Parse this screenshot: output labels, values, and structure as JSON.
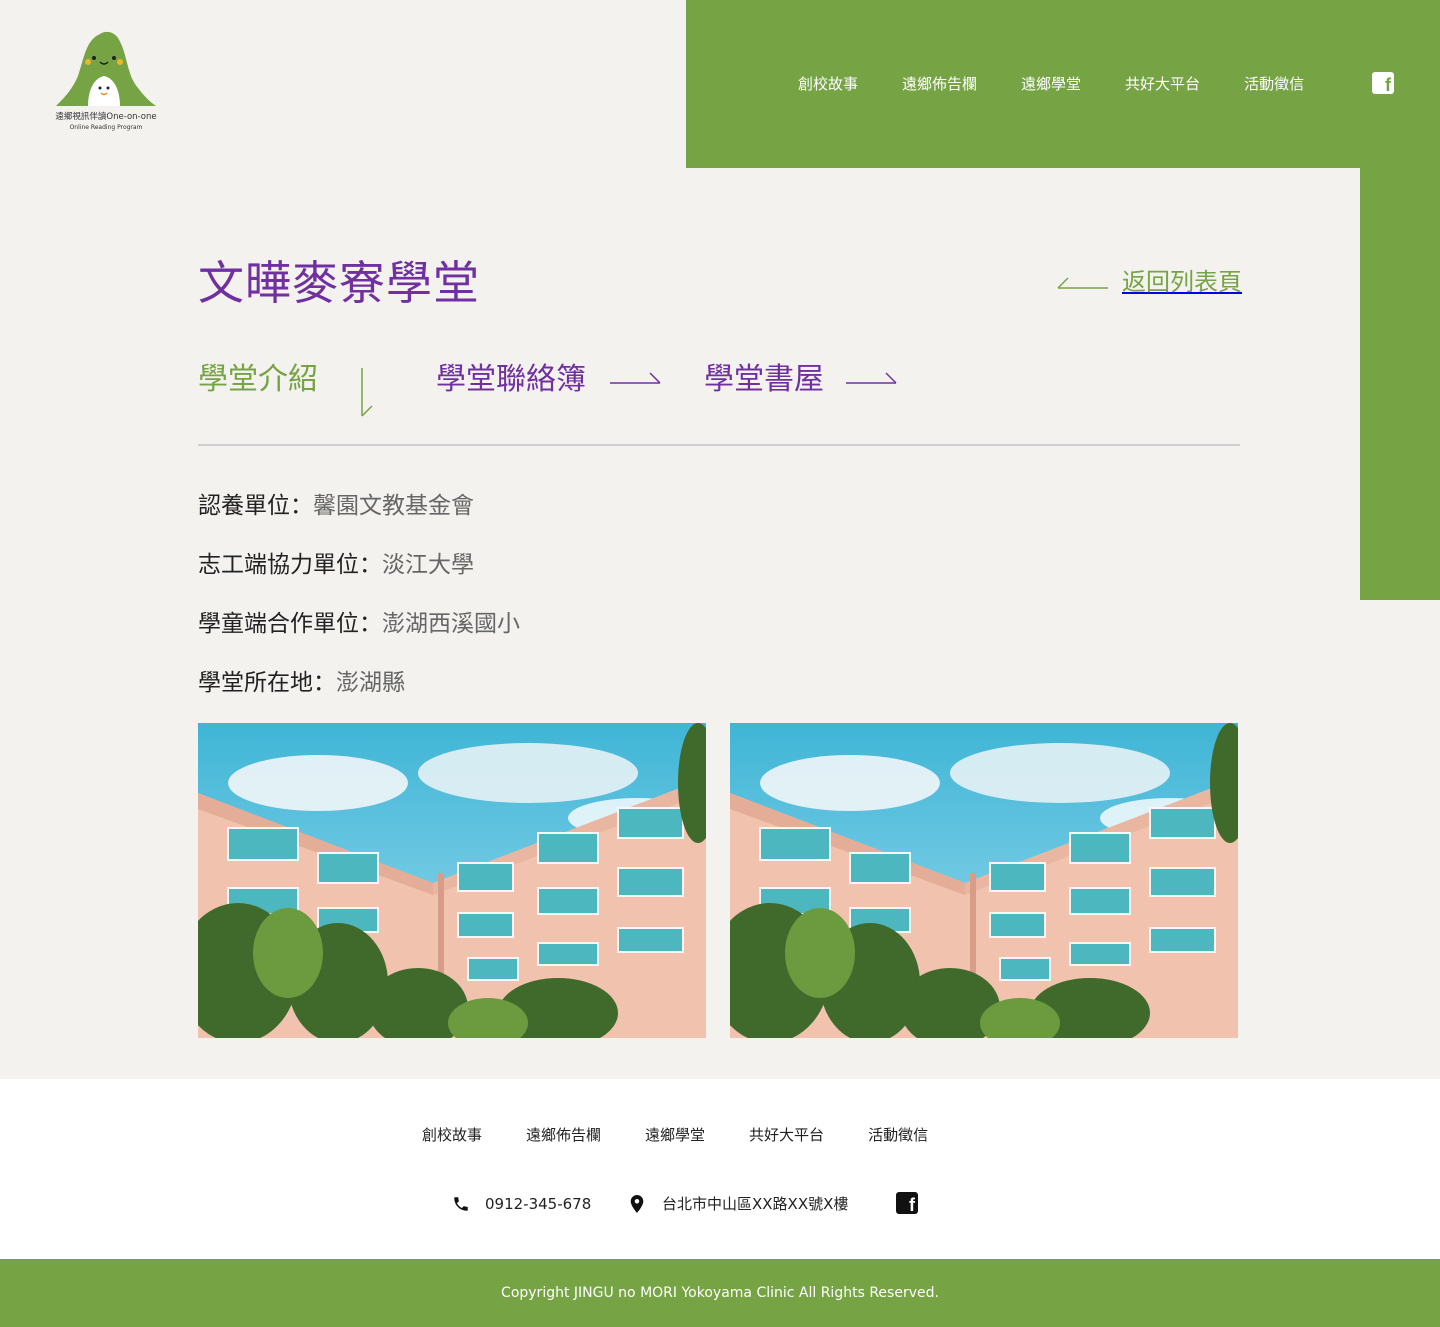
{
  "logo": {
    "brand": "遠鄉視訊伴讀One-on-one",
    "sub": "Online Reading Program"
  },
  "nav": {
    "items": [
      "創校故事",
      "遠鄉佈告欄",
      "遠鄉學堂",
      "共好大平台",
      "活動徵信"
    ],
    "facebook_icon": "facebook-icon"
  },
  "page": {
    "title": "文曄麥寮學堂",
    "back_label": "返回列表頁"
  },
  "tabs": {
    "intro": "學堂介紹",
    "contact": "學堂聯絡簿",
    "books": "學堂書屋"
  },
  "info": [
    {
      "label": "認養單位：",
      "value": "馨園文教基金會"
    },
    {
      "label": "志工端協力單位：",
      "value": "淡江大學"
    },
    {
      "label": "學童端合作單位：",
      "value": "澎湖西溪國小"
    },
    {
      "label": "學堂所在地：",
      "value": "澎湖縣"
    }
  ],
  "footer": {
    "nav": [
      "創校故事",
      "遠鄉佈告欄",
      "遠鄉學堂",
      "共好大平台",
      "活動徵信"
    ],
    "phone": "0912-345-678",
    "address": "台北市中山區XX路XX號X樓",
    "copyright": "Copyright JINGU no MORI Yokoyama Clinic All Rights Reserved."
  },
  "colors": {
    "green": "#76a344",
    "purple": "#7030a0",
    "background": "#f3f2ef"
  }
}
